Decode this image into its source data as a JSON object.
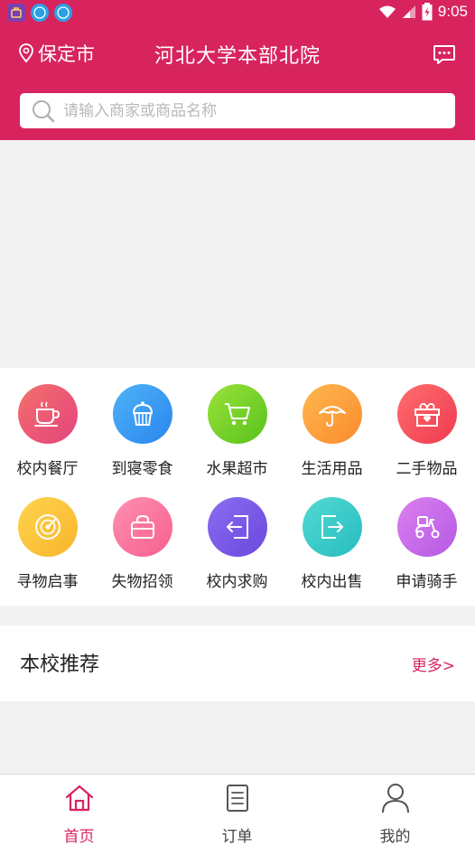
{
  "status_bar": {
    "time": "9:05"
  },
  "header": {
    "city": "保定市",
    "title": "河北大学本部北院",
    "search_placeholder": "请输入商家或商品名称"
  },
  "categories": [
    {
      "label": "校内餐厅",
      "icon": "coffee-cup-icon",
      "color_from": "#f4706a",
      "color_to": "#e3447d"
    },
    {
      "label": "到寝零食",
      "icon": "cupcake-icon",
      "color_from": "#4fb2f6",
      "color_to": "#2a86ee"
    },
    {
      "label": "水果超市",
      "icon": "shopping-cart-icon",
      "color_from": "#9ae23a",
      "color_to": "#58c21c"
    },
    {
      "label": "生活用品",
      "icon": "umbrella-icon",
      "color_from": "#ffb84f",
      "color_to": "#fb8a2e"
    },
    {
      "label": "二手物品",
      "icon": "gift-box-icon",
      "color_from": "#ff6e6e",
      "color_to": "#ef3a50"
    },
    {
      "label": "寻物启事",
      "icon": "radar-icon",
      "color_from": "#ffd44f",
      "color_to": "#f7b52a"
    },
    {
      "label": "失物招领",
      "icon": "handbag-icon",
      "color_from": "#ff8fb2",
      "color_to": "#f6608f"
    },
    {
      "label": "校内求购",
      "icon": "arrow-in-icon",
      "color_from": "#8a6df0",
      "color_to": "#6a48de"
    },
    {
      "label": "校内出售",
      "icon": "arrow-out-icon",
      "color_from": "#53dad2",
      "color_to": "#26bcc0"
    },
    {
      "label": "申请骑手",
      "icon": "scooter-icon",
      "color_from": "#dc80f0",
      "color_to": "#b459e3"
    }
  ],
  "recommend": {
    "title": "本校推荐",
    "more": "更多>"
  },
  "tabs": [
    {
      "label": "首页",
      "icon": "home-icon",
      "active": true
    },
    {
      "label": "订单",
      "icon": "order-list-icon",
      "active": false
    },
    {
      "label": "我的",
      "icon": "user-icon",
      "active": false
    }
  ],
  "colors": {
    "brand": "#d8245e",
    "background": "#f2f2f2"
  }
}
